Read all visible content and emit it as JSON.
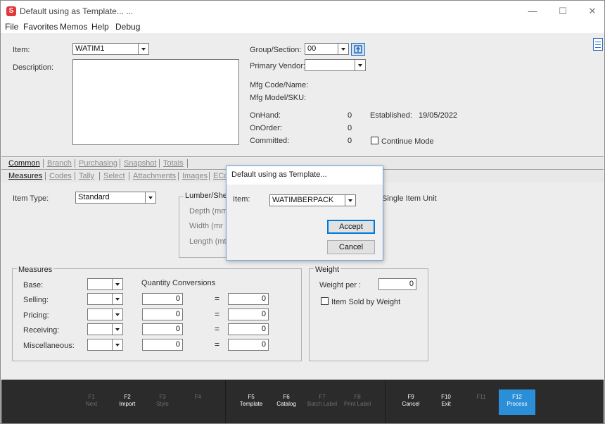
{
  "window": {
    "title": "Default using as Template... ...",
    "app_icon": "S",
    "controls": [
      "—",
      "☐",
      "✕"
    ]
  },
  "menu": [
    "File",
    "Favorites",
    "Memos",
    "Help",
    "Debug"
  ],
  "header": {
    "item_label": "Item:",
    "item_value": "WATIM1",
    "description_label": "Description:",
    "description_value": "",
    "group_label": "Group/Section:",
    "group_value": "00",
    "vendor_label": "Primary Vendor:",
    "vendor_value": "",
    "mfg_code_label": "Mfg Code/Name:",
    "mfg_model_label": "Mfg Model/SKU:",
    "onhand_label": "OnHand:",
    "onhand_value": "0",
    "onorder_label": "OnOrder:",
    "onorder_value": "0",
    "committed_label": "Committed:",
    "committed_value": "0",
    "established_label": "Established:",
    "established_value": "19/05/2022",
    "continue_mode_label": "Continue Mode"
  },
  "tabs_top": [
    "Common",
    "Branch",
    "Purchasing",
    "Snapshot",
    "Totals"
  ],
  "tabs_sub": [
    "Measures",
    "Codes",
    "Tally",
    "Select",
    "Attachments",
    "Images",
    "ECo"
  ],
  "measures_tab": {
    "item_type_label": "Item Type:",
    "item_type_value": "Standard",
    "lumber_title": "Lumber/Shee",
    "depth_label": "Depth (mm",
    "width_label": "Width    (mr",
    "length_label": "Length (mtr",
    "single_item_unit_label": "Single Item Unit"
  },
  "measures_group": {
    "title": "Measures",
    "quantity_conversions_label": "Quantity Conversions",
    "rows": [
      {
        "label": "Base:"
      },
      {
        "label": "Selling:",
        "qty": "0",
        "eq": "=",
        "conv": "0"
      },
      {
        "label": "Pricing:",
        "qty": "0",
        "eq": "=",
        "conv": "0"
      },
      {
        "label": "Receiving:",
        "qty": "0",
        "eq": "=",
        "conv": "0"
      },
      {
        "label": "Miscellaneous:",
        "qty": "0",
        "eq": "=",
        "conv": "0"
      }
    ]
  },
  "weight_group": {
    "title": "Weight",
    "weight_per_label": "Weight per :",
    "weight_per_value": "0",
    "sold_by_weight_label": "Item Sold by Weight"
  },
  "dialog": {
    "title": "Default using as Template...",
    "item_label": "Item:",
    "item_value": "WATIMBERPACK",
    "accept_label": "Accept",
    "cancel_label": "Cancel"
  },
  "footer_keys": [
    {
      "key": "F1",
      "label": "Next"
    },
    {
      "key": "F2",
      "label": "Import"
    },
    {
      "key": "F3",
      "label": "Style"
    },
    {
      "key": "F4",
      "label": ""
    },
    {
      "key": "F5",
      "label": "Template"
    },
    {
      "key": "F6",
      "label": "Catalog"
    },
    {
      "key": "F7",
      "label": "Batch Label"
    },
    {
      "key": "F8",
      "label": "Print Label"
    },
    {
      "key": "F9",
      "label": "Cancel"
    },
    {
      "key": "F10",
      "label": "Exit"
    },
    {
      "key": "F11",
      "label": ""
    },
    {
      "key": "F12",
      "label": "Process"
    }
  ],
  "colors": {
    "accent": "#2a8fd8",
    "footer_bg": "#2b2b2b",
    "app_icon": "#e0383b"
  }
}
